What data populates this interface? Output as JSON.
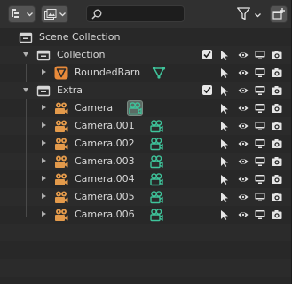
{
  "header": {
    "display_mode_icon": "outliner-list-icon",
    "view_layer_icon": "image-icon",
    "search": {
      "value": "",
      "placeholder": ""
    },
    "filter_icon": "funnel-icon",
    "new_collection_icon": "new-collection-icon"
  },
  "outliner": {
    "root": {
      "label": "Scene Collection",
      "icon": "collection-icon"
    },
    "collection": {
      "label": "Collection",
      "checked": true,
      "children": [
        {
          "label": "RoundedBarn",
          "icon": "orange-mesh-icon",
          "data_icon": "mesh-data-icon"
        }
      ]
    },
    "extra": {
      "label": "Extra",
      "checked": true,
      "children": [
        {
          "label": "Camera",
          "icon": "camera-object-icon",
          "data_icon": "camera-data-icon",
          "active": true
        },
        {
          "label": "Camera.001",
          "icon": "camera-object-icon",
          "data_icon": "camera-data-icon"
        },
        {
          "label": "Camera.002",
          "icon": "camera-object-icon",
          "data_icon": "camera-data-icon"
        },
        {
          "label": "Camera.003",
          "icon": "camera-object-icon",
          "data_icon": "camera-data-icon"
        },
        {
          "label": "Camera.004",
          "icon": "camera-object-icon",
          "data_icon": "camera-data-icon"
        },
        {
          "label": "Camera.005",
          "icon": "camera-object-icon",
          "data_icon": "camera-data-icon"
        },
        {
          "label": "Camera.006",
          "icon": "camera-object-icon",
          "data_icon": "camera-data-icon"
        }
      ]
    },
    "row_controls": [
      "select-arrow-icon",
      "eye-icon",
      "monitor-icon",
      "camera-render-icon"
    ]
  },
  "colors": {
    "background": "#282828",
    "header": "#303030",
    "camera_icon": "#e39a4b",
    "camera_data_icon": "#3fc49b",
    "mesh_badge": "#e88a3a",
    "text": "#d8d8d8"
  }
}
